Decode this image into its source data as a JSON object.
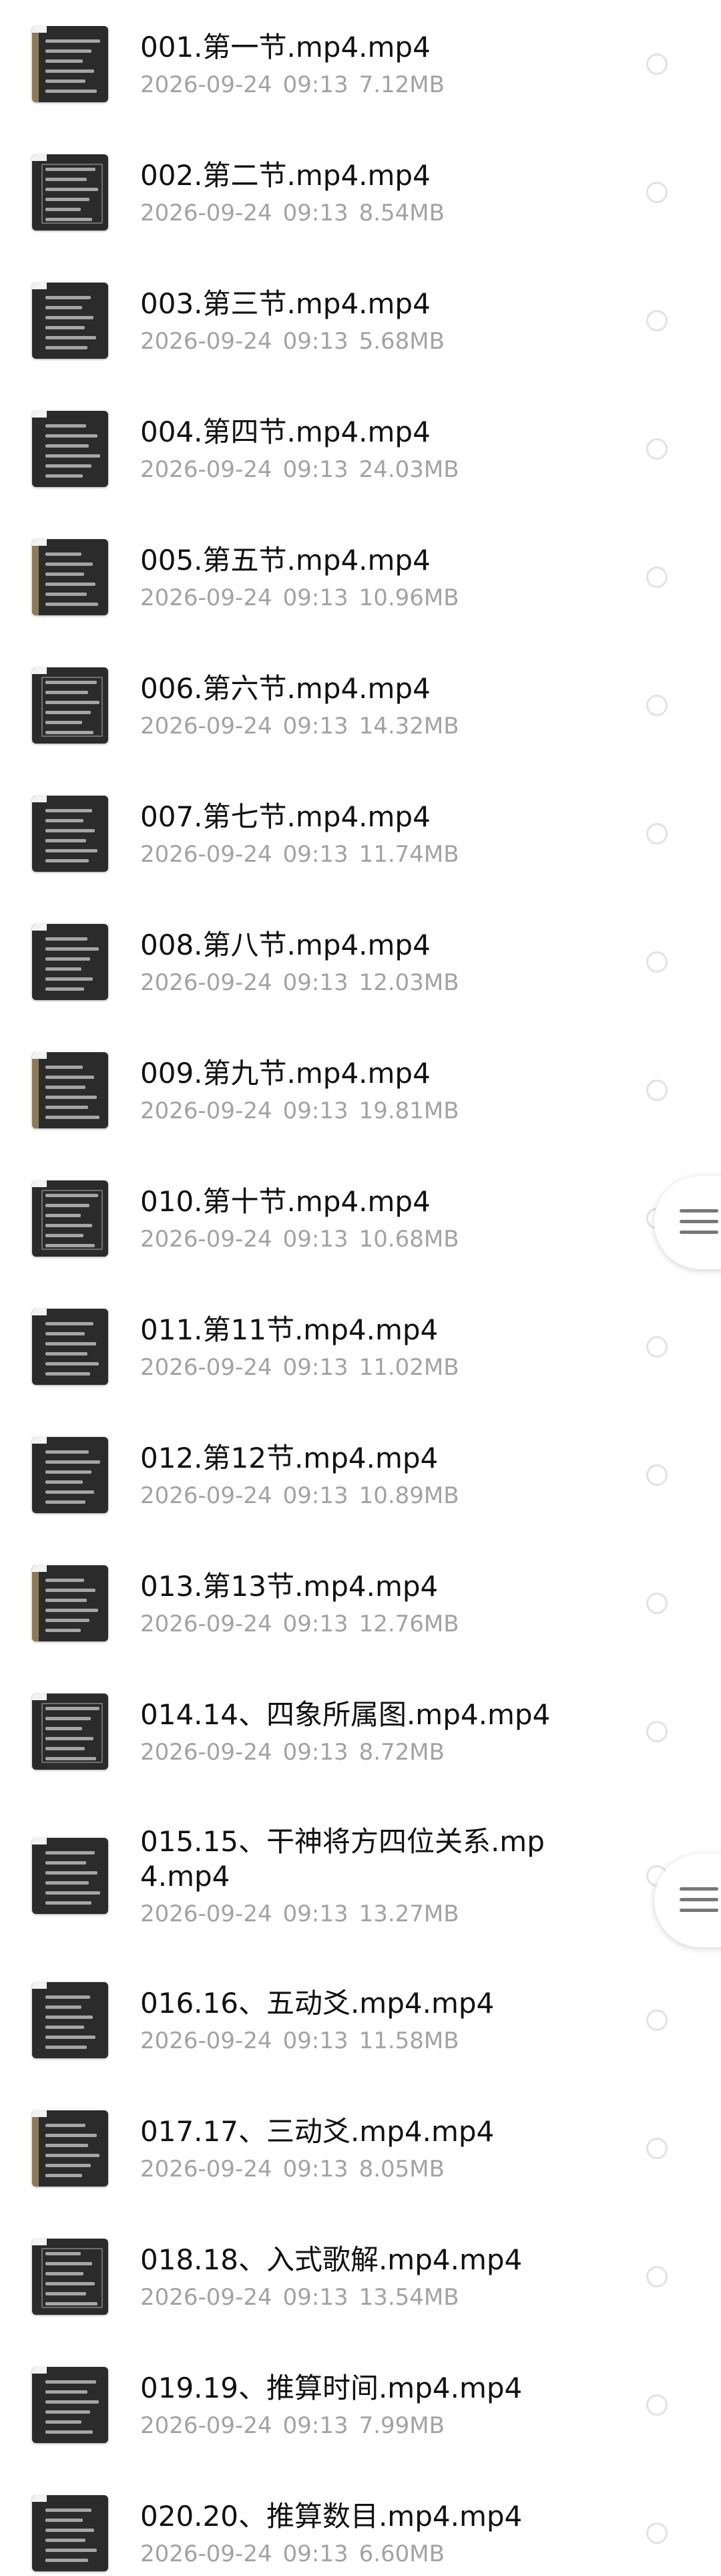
{
  "files": [
    {
      "name": "001.第一节.mp4.mp4",
      "date": "2026-09-24",
      "time": "09:13",
      "size": "7.12MB"
    },
    {
      "name": "002.第二节.mp4.mp4",
      "date": "2026-09-24",
      "time": "09:13",
      "size": "8.54MB"
    },
    {
      "name": "003.第三节.mp4.mp4",
      "date": "2026-09-24",
      "time": "09:13",
      "size": "5.68MB"
    },
    {
      "name": "004.第四节.mp4.mp4",
      "date": "2026-09-24",
      "time": "09:13",
      "size": "24.03MB"
    },
    {
      "name": "005.第五节.mp4.mp4",
      "date": "2026-09-24",
      "time": "09:13",
      "size": "10.96MB"
    },
    {
      "name": "006.第六节.mp4.mp4",
      "date": "2026-09-24",
      "time": "09:13",
      "size": "14.32MB"
    },
    {
      "name": "007.第七节.mp4.mp4",
      "date": "2026-09-24",
      "time": "09:13",
      "size": "11.74MB"
    },
    {
      "name": "008.第八节.mp4.mp4",
      "date": "2026-09-24",
      "time": "09:13",
      "size": "12.03MB"
    },
    {
      "name": "009.第九节.mp4.mp4",
      "date": "2026-09-24",
      "time": "09:13",
      "size": "19.81MB"
    },
    {
      "name": "010.第十节.mp4.mp4",
      "date": "2026-09-24",
      "time": "09:13",
      "size": "10.68MB"
    },
    {
      "name": "011.第11节.mp4.mp4",
      "date": "2026-09-24",
      "time": "09:13",
      "size": "11.02MB"
    },
    {
      "name": "012.第12节.mp4.mp4",
      "date": "2026-09-24",
      "time": "09:13",
      "size": "10.89MB"
    },
    {
      "name": "013.第13节.mp4.mp4",
      "date": "2026-09-24",
      "time": "09:13",
      "size": "12.76MB"
    },
    {
      "name": "014.14、四象所属图.mp4.mp4",
      "date": "2026-09-24",
      "time": "09:13",
      "size": "8.72MB"
    },
    {
      "name": "015.15、干神将方四位关系.mp4.mp4",
      "date": "2026-09-24",
      "time": "09:13",
      "size": "13.27MB"
    },
    {
      "name": "016.16、五动爻.mp4.mp4",
      "date": "2026-09-24",
      "time": "09:13",
      "size": "11.58MB"
    },
    {
      "name": "017.17、三动爻.mp4.mp4",
      "date": "2026-09-24",
      "time": "09:13",
      "size": "8.05MB"
    },
    {
      "name": "018.18、入式歌解.mp4.mp4",
      "date": "2026-09-24",
      "time": "09:13",
      "size": "13.54MB"
    },
    {
      "name": "019.19、推算时间.mp4.mp4",
      "date": "2026-09-24",
      "time": "09:13",
      "size": "7.99MB"
    },
    {
      "name": "020.20、推算数目.mp4.mp4",
      "date": "2026-09-24",
      "time": "09:13",
      "size": "6.60MB"
    }
  ]
}
